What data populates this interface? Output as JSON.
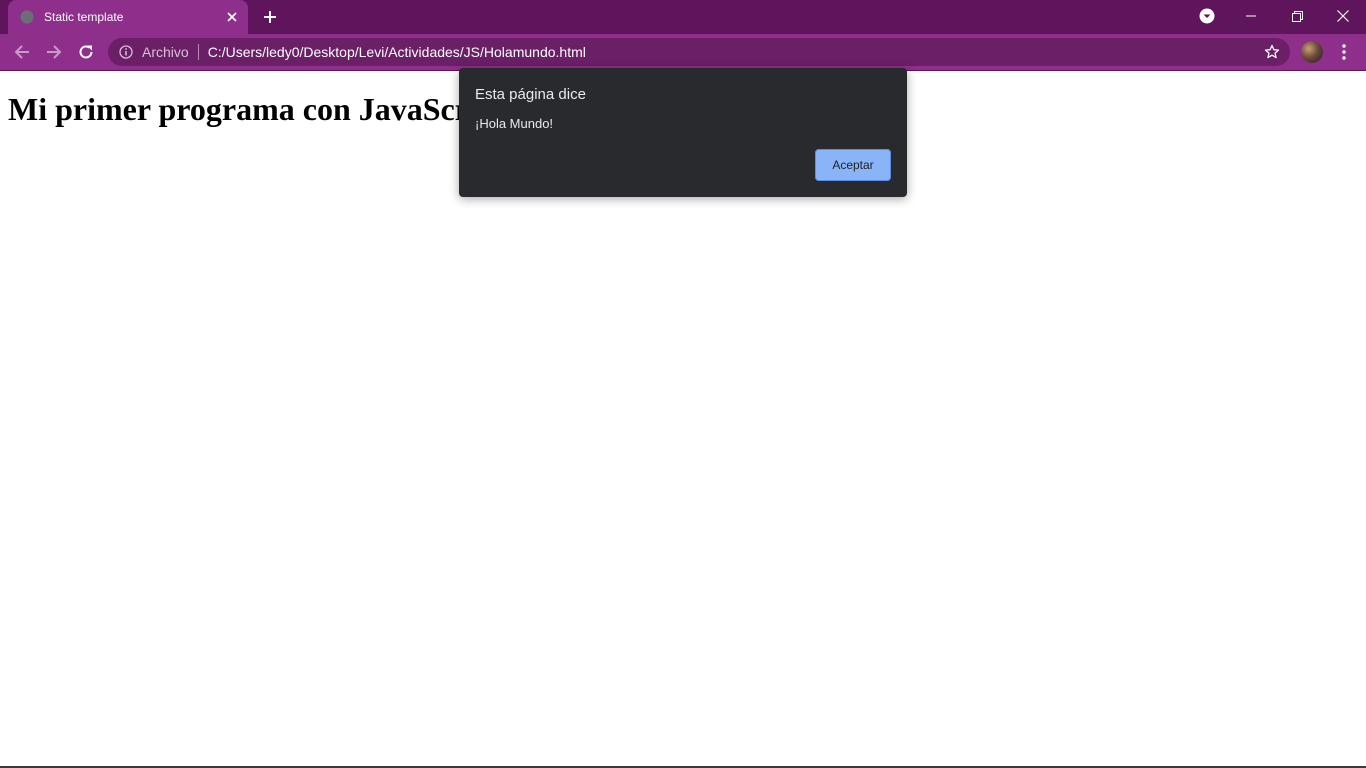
{
  "browser": {
    "tab": {
      "title": "Static template",
      "favicon": "globe-icon"
    },
    "address_bar": {
      "scheme_label": "Archivo",
      "url": "C:/Users/ledy0/Desktop/Levi/Actividades/JS/Holamundo.html"
    },
    "colors": {
      "frame": "#5e155c",
      "toolbar": "#8f2f8c",
      "omnibox": "#6a1f67"
    }
  },
  "page": {
    "heading": "Mi primer programa con JavaScript"
  },
  "dialog": {
    "title": "Esta página dice",
    "message": "¡Hola Mundo!",
    "ok_label": "Aceptar",
    "button_color": "#8ab4f8"
  }
}
